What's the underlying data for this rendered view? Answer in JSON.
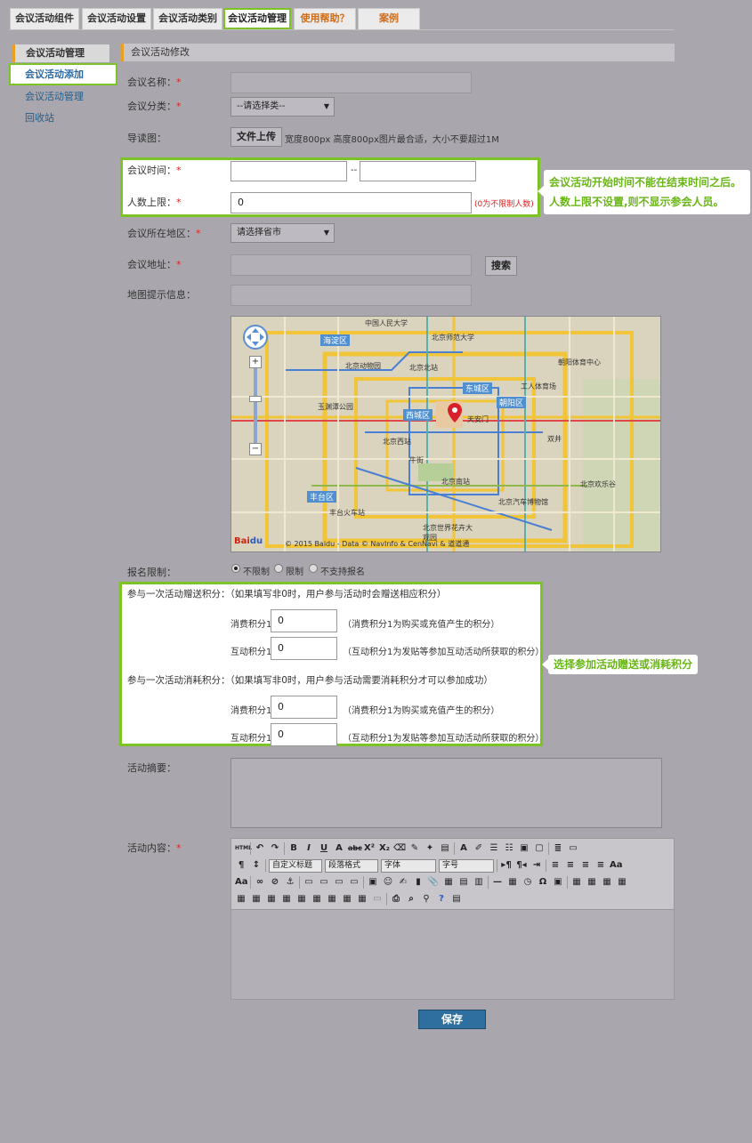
{
  "tabs": [
    {
      "label": "会议活动组件"
    },
    {
      "label": "会议活动设置"
    },
    {
      "label": "会议活动类别"
    },
    {
      "label": "会议活动管理"
    },
    {
      "label": "使用帮助？"
    },
    {
      "label": "案例"
    }
  ],
  "sidebar": {
    "heading": "会议活动管理",
    "items": [
      {
        "label": "会议活动添加"
      },
      {
        "label": "会议活动管理"
      },
      {
        "label": "回收站"
      }
    ]
  },
  "section_title": "会议活动修改",
  "form": {
    "name_label": "会议名称：",
    "category_label": "会议分类：",
    "category_value": "--请选择类--",
    "cover_label": "导读图：",
    "upload_button": "文件上传",
    "upload_hint": "宽度800px 高度800px图片最合适，大小不要超过1M",
    "time_label": "会议时间：",
    "time_separator": "--",
    "limit_label": "人数上限：",
    "limit_value": "0",
    "limit_hint": "(0为不限制人数)",
    "region_label": "会议所在地区：",
    "region_value": "请选择省市",
    "address_label": "会议地址：",
    "search_button": "搜索",
    "map_hint_label": "地图提示信息：",
    "signup_label": "报名限制：",
    "signup_options": [
      "不限制",
      "限制",
      "不支持报名"
    ],
    "gift_heading": "参与一次活动赠送积分：（如果填写非0时，用户参与活动时会赠送相应积分）",
    "cost_heading": "参与一次活动消耗积分：（如果填写非0时，用户参与活动需要消耗积分才可以参加成功）",
    "points_consume_label": "消费积分1",
    "points_interact_label": "互动积分1",
    "points_consume_hint": "（消费积分1为购买或充值产生的积分）",
    "points_interact_hint": "（互动积分1为发贴等参加互动活动所获取的积分）",
    "points_value": "0",
    "summary_label": "活动摘要：",
    "content_label": "活动内容：",
    "save_button": "保存"
  },
  "map": {
    "copyright": "© 2015 Baidu - Data © NavInfo & CenNavi & 道道通",
    "labels": [
      "中国人民大学",
      "北京师范大学",
      "海淀区",
      "北京动物园",
      "北京北站",
      "东城区",
      "朝阳区",
      "玉渊潭公园",
      "西城区",
      "天安门",
      "北京西站",
      "丰台区",
      "北京南站",
      "牛街",
      "丰台火车站",
      "北京世界花卉大观园",
      "朝阳体育中心",
      "工人体育场",
      "双井",
      "北京欢乐谷",
      "北京汽车博物馆"
    ]
  },
  "editor": {
    "selects": [
      "自定义标题",
      "段落格式",
      "字体",
      "字号"
    ]
  },
  "callouts": {
    "time_note_1": "会议活动开始时间不能在结束时间之后。",
    "time_note_2": "人数上限不设置,则不显示参会人员。",
    "points_note": "选择参加活动赠送或消耗积分"
  },
  "colors": {
    "highlight": "#7cc423",
    "callout_text": "#6ab617",
    "accent": "#e8a020",
    "link": "#1f5d8f"
  }
}
